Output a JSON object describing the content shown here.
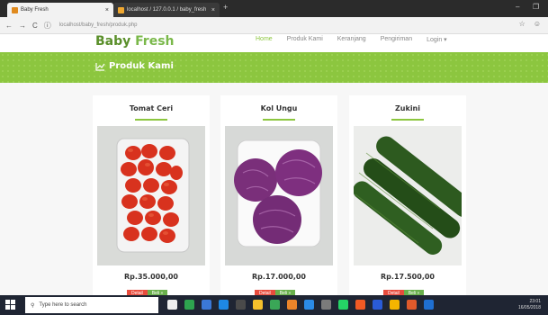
{
  "browser": {
    "tabs": [
      {
        "label": "Baby Fresh",
        "favicon_color": "#e08a1e"
      },
      {
        "label": "localhost / 127.0.0.1 / baby_fresh",
        "favicon_color": "#f0a830"
      }
    ],
    "url_host": "localhost",
    "url_path": "/baby_fresh/produk.php"
  },
  "site": {
    "logo_a": "Baby",
    "logo_b": "Fresh",
    "nav": [
      "Home",
      "Produk Kami",
      "Keranjang",
      "Pengiriman",
      "Login ▾"
    ],
    "banner_title": "Produk Kami",
    "accent_color": "#8cc63f"
  },
  "products": [
    {
      "name": "Tomat Ceri",
      "price": "Rp.35.000,00",
      "detail_label": "Detail",
      "buy_label": "Beli »"
    },
    {
      "name": "Kol Ungu",
      "price": "Rp.17.000,00",
      "detail_label": "Detail",
      "buy_label": "Beli »"
    },
    {
      "name": "Zukini",
      "price": "Rp.17.500,00",
      "detail_label": "Detail",
      "buy_label": "Beli »"
    }
  ],
  "taskbar": {
    "search_placeholder": "Type here to search",
    "time": "23:01",
    "date": "16/05/2018"
  }
}
